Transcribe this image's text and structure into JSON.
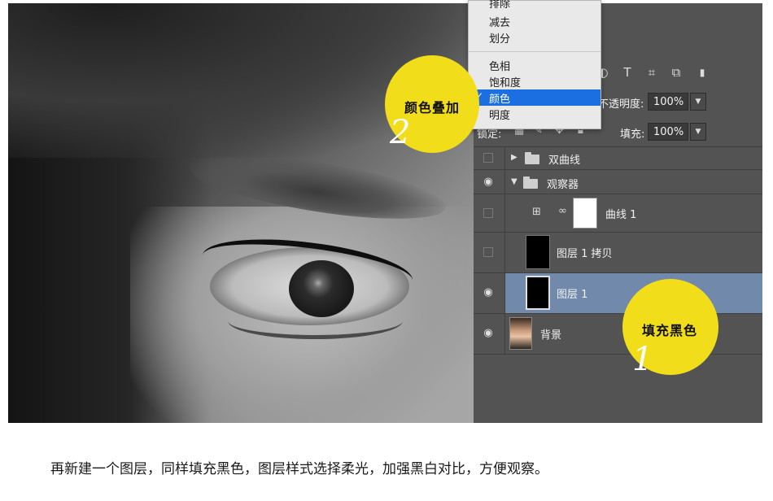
{
  "blend_menu": {
    "items_top": [
      "排除",
      "减去",
      "划分"
    ],
    "items_bottom": [
      "色相",
      "饱和度",
      "颜色",
      "明度"
    ],
    "selected": "颜色",
    "check_mark": "✓"
  },
  "layers_panel": {
    "toolbar_icons": [
      "text-tool-icon",
      "transform-icon",
      "smart-object-icon",
      "adjustment-icon"
    ],
    "opacity_label": "不透明度:",
    "opacity_value": "100%",
    "lock_label": "锁定:",
    "fill_label": "填充:",
    "fill_value": "100%",
    "layers": [
      {
        "name": "双曲线",
        "type": "group",
        "visible": false,
        "collapsed": true
      },
      {
        "name": "观察器",
        "type": "group",
        "visible": true,
        "collapsed": false
      },
      {
        "name": "曲线 1",
        "type": "adjustment",
        "visible": false
      },
      {
        "name": "图层 1 拷贝",
        "type": "layer",
        "visible": false
      },
      {
        "name": "图层 1",
        "type": "layer",
        "visible": true,
        "selected": true
      },
      {
        "name": "背景",
        "type": "background",
        "visible": true
      }
    ]
  },
  "callouts": [
    {
      "text": "颜色叠加",
      "number": "2"
    },
    {
      "text": "填充黑色",
      "number": "1"
    }
  ],
  "caption": "再新建一个图层，同样填充黑色，图层样式选择柔光，加强黑白对比，方便观察。",
  "colors": {
    "accent_yellow": "#f2dd1a",
    "selection_blue": "#1b6fe0",
    "selected_layer": "#7189aa",
    "panel_bg": "#535353"
  }
}
